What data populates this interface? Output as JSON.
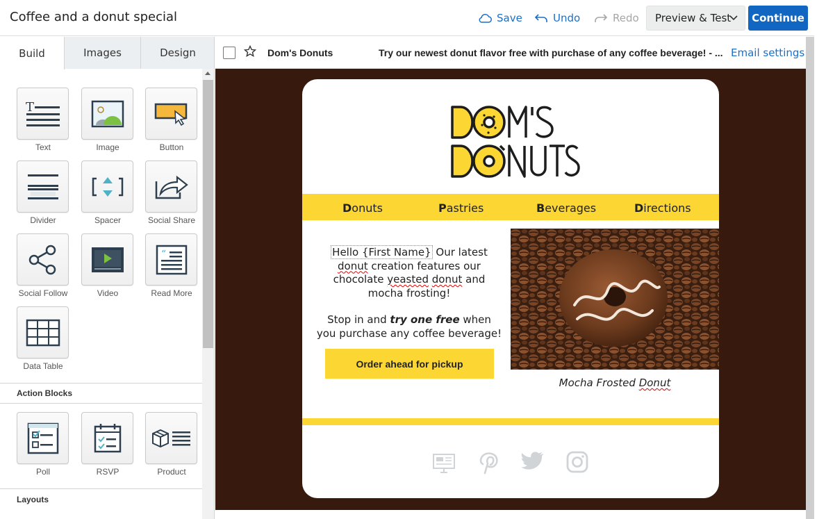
{
  "app": {
    "title": "Coffee and a donut special"
  },
  "toolbar": {
    "save_label": "Save",
    "undo_label": "Undo",
    "redo_label": "Redo",
    "preview_label": "Preview & Test",
    "continue_label": "Continue"
  },
  "left_panel": {
    "tabs": [
      {
        "label": "Build",
        "active": true
      },
      {
        "label": "Images",
        "active": false
      },
      {
        "label": "Design",
        "active": false
      }
    ],
    "blocks": [
      {
        "label": "Text",
        "icon": "text-icon"
      },
      {
        "label": "Image",
        "icon": "image-icon"
      },
      {
        "label": "Button",
        "icon": "button-icon"
      },
      {
        "label": "Divider",
        "icon": "divider-icon"
      },
      {
        "label": "Spacer",
        "icon": "spacer-icon"
      },
      {
        "label": "Social Share",
        "icon": "social-share-icon"
      },
      {
        "label": "Social Follow",
        "icon": "social-follow-icon"
      },
      {
        "label": "Video",
        "icon": "video-icon"
      },
      {
        "label": "Read More",
        "icon": "read-more-icon"
      },
      {
        "label": "Data Table",
        "icon": "data-table-icon"
      }
    ],
    "action_blocks_heading": "Action Blocks",
    "action_blocks": [
      {
        "label": "Poll",
        "icon": "poll-icon"
      },
      {
        "label": "RSVP",
        "icon": "rsvp-icon"
      },
      {
        "label": "Product",
        "icon": "product-icon"
      }
    ],
    "layouts_heading": "Layouts"
  },
  "email_header": {
    "from": "Dom's Donuts",
    "subject": "Try our newest donut flavor free with purchase of any coffee beverage! - ...",
    "settings_link": "Email settings"
  },
  "email": {
    "nav": [
      {
        "first": "D",
        "rest": "onuts"
      },
      {
        "first": "P",
        "rest": "astries"
      },
      {
        "first": "B",
        "rest": "everages"
      },
      {
        "first": "D",
        "rest": "irections"
      }
    ],
    "greeting_token": "Hello {First Name}",
    "para1_a": " Our latest ",
    "para1_donut": "donut",
    "para1_b": " creation features our chocolate ",
    "para1_yeasted": "yeasted",
    "para1_c": " ",
    "para1_donut2": "donut",
    "para1_d": " and mocha frosting!",
    "para2_a": "Stop in and ",
    "para2_em": "try one free",
    "para2_b": " when you purchase any coffee beverage!",
    "cta_label": "Order ahead for pickup",
    "caption_a": "Mocha Frosted ",
    "caption_b": "Donut",
    "social_icons": [
      "website-icon",
      "pinterest-icon",
      "twitter-icon",
      "instagram-icon"
    ]
  },
  "colors": {
    "accent_blue": "#1166c2",
    "brand_yellow": "#fcd734",
    "canvas_brown": "#37190d"
  }
}
